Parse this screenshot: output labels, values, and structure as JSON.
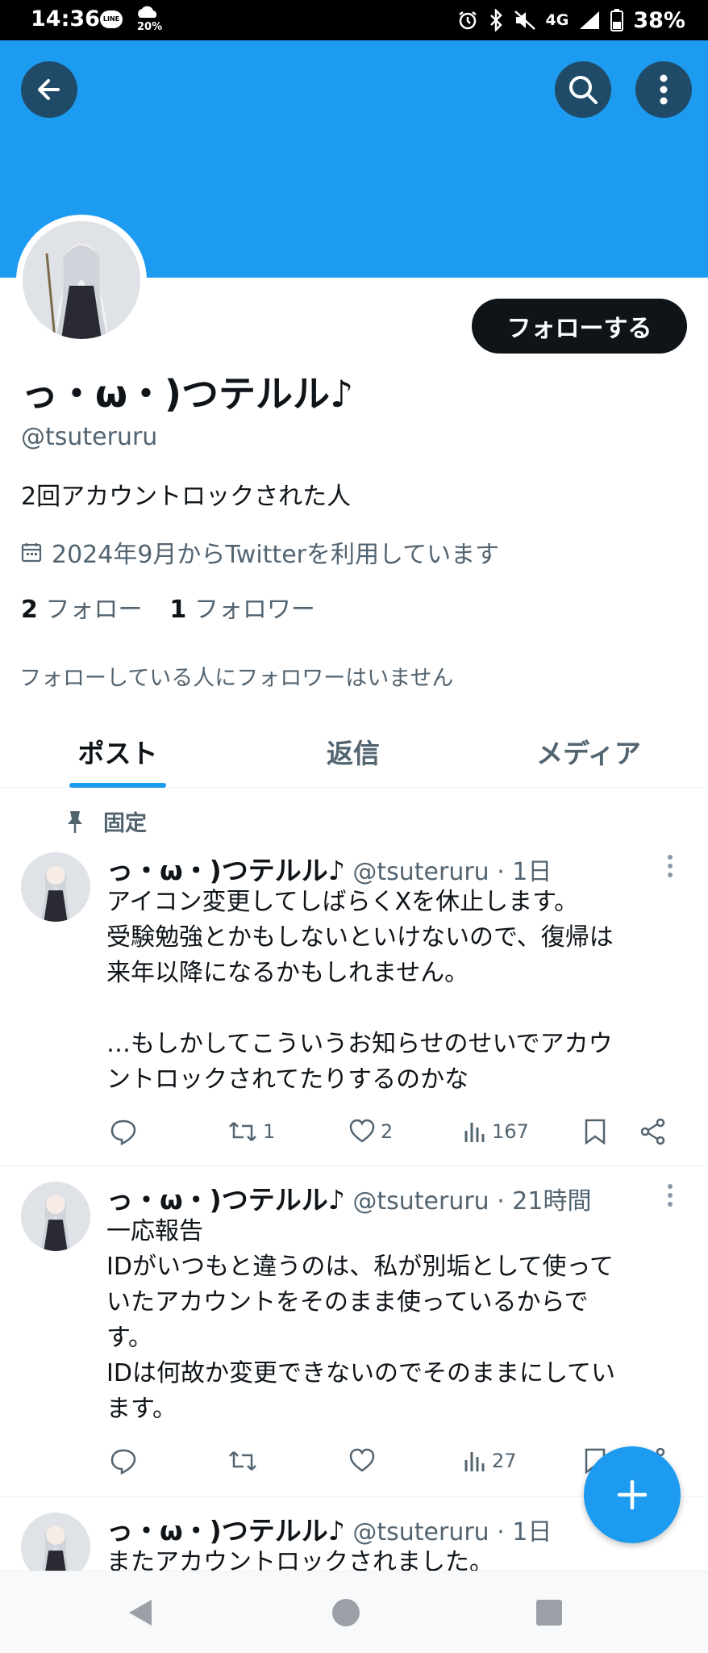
{
  "status_bar": {
    "time": "14:36",
    "line_badge": "LINE",
    "weather_pct": "20%",
    "network": "4G",
    "battery": "38%"
  },
  "profile": {
    "display_name": "っ・ω・)つテルル♪",
    "handle": "@tsuteruru",
    "bio": "2回アカウントロックされた人",
    "joined": "2024年9月からTwitterを利用しています",
    "following_count": "2",
    "following_label": "フォロー",
    "followers_count": "1",
    "followers_label": "フォロワー",
    "followers_note": "フォローしている人にフォロワーはいません",
    "follow_button": "フォローする"
  },
  "tabs": [
    {
      "label": "ポスト",
      "active": true
    },
    {
      "label": "返信",
      "active": false
    },
    {
      "label": "メディア",
      "active": false
    }
  ],
  "pinned_label": "固定",
  "posts": [
    {
      "name": "っ・ω・)つテルル♪",
      "meta": "@tsuteruru · 1日",
      "body": "アイコン変更してしばらくXを休止します。\n受験勉強とかもしないといけないので、復帰は\n来年以降になるかもしれません。\n\n…もしかしてこういうお知らせのせいでアカウ\nントロックされてたりするのかな",
      "reposts": "1",
      "likes": "2",
      "views": "167"
    },
    {
      "name": "っ・ω・)つテルル♪",
      "meta": "@tsuteruru · 21時間",
      "body": "一応報告\nIDがいつもと違うのは、私が別垢として使って\nいたアカウントをそのまま使っているからで\nす。\nIDは何故か変更できないのでそのままにしてい\nます。",
      "reposts": "",
      "likes": "",
      "views": "27"
    },
    {
      "name": "っ・ω・)つテルル♪",
      "meta": "@tsuteruru · 1日",
      "body": "またアカウントロックされました。"
    }
  ],
  "colors": {
    "accent": "#1d9bf0",
    "text": "#0f1419",
    "muted": "#536471"
  }
}
